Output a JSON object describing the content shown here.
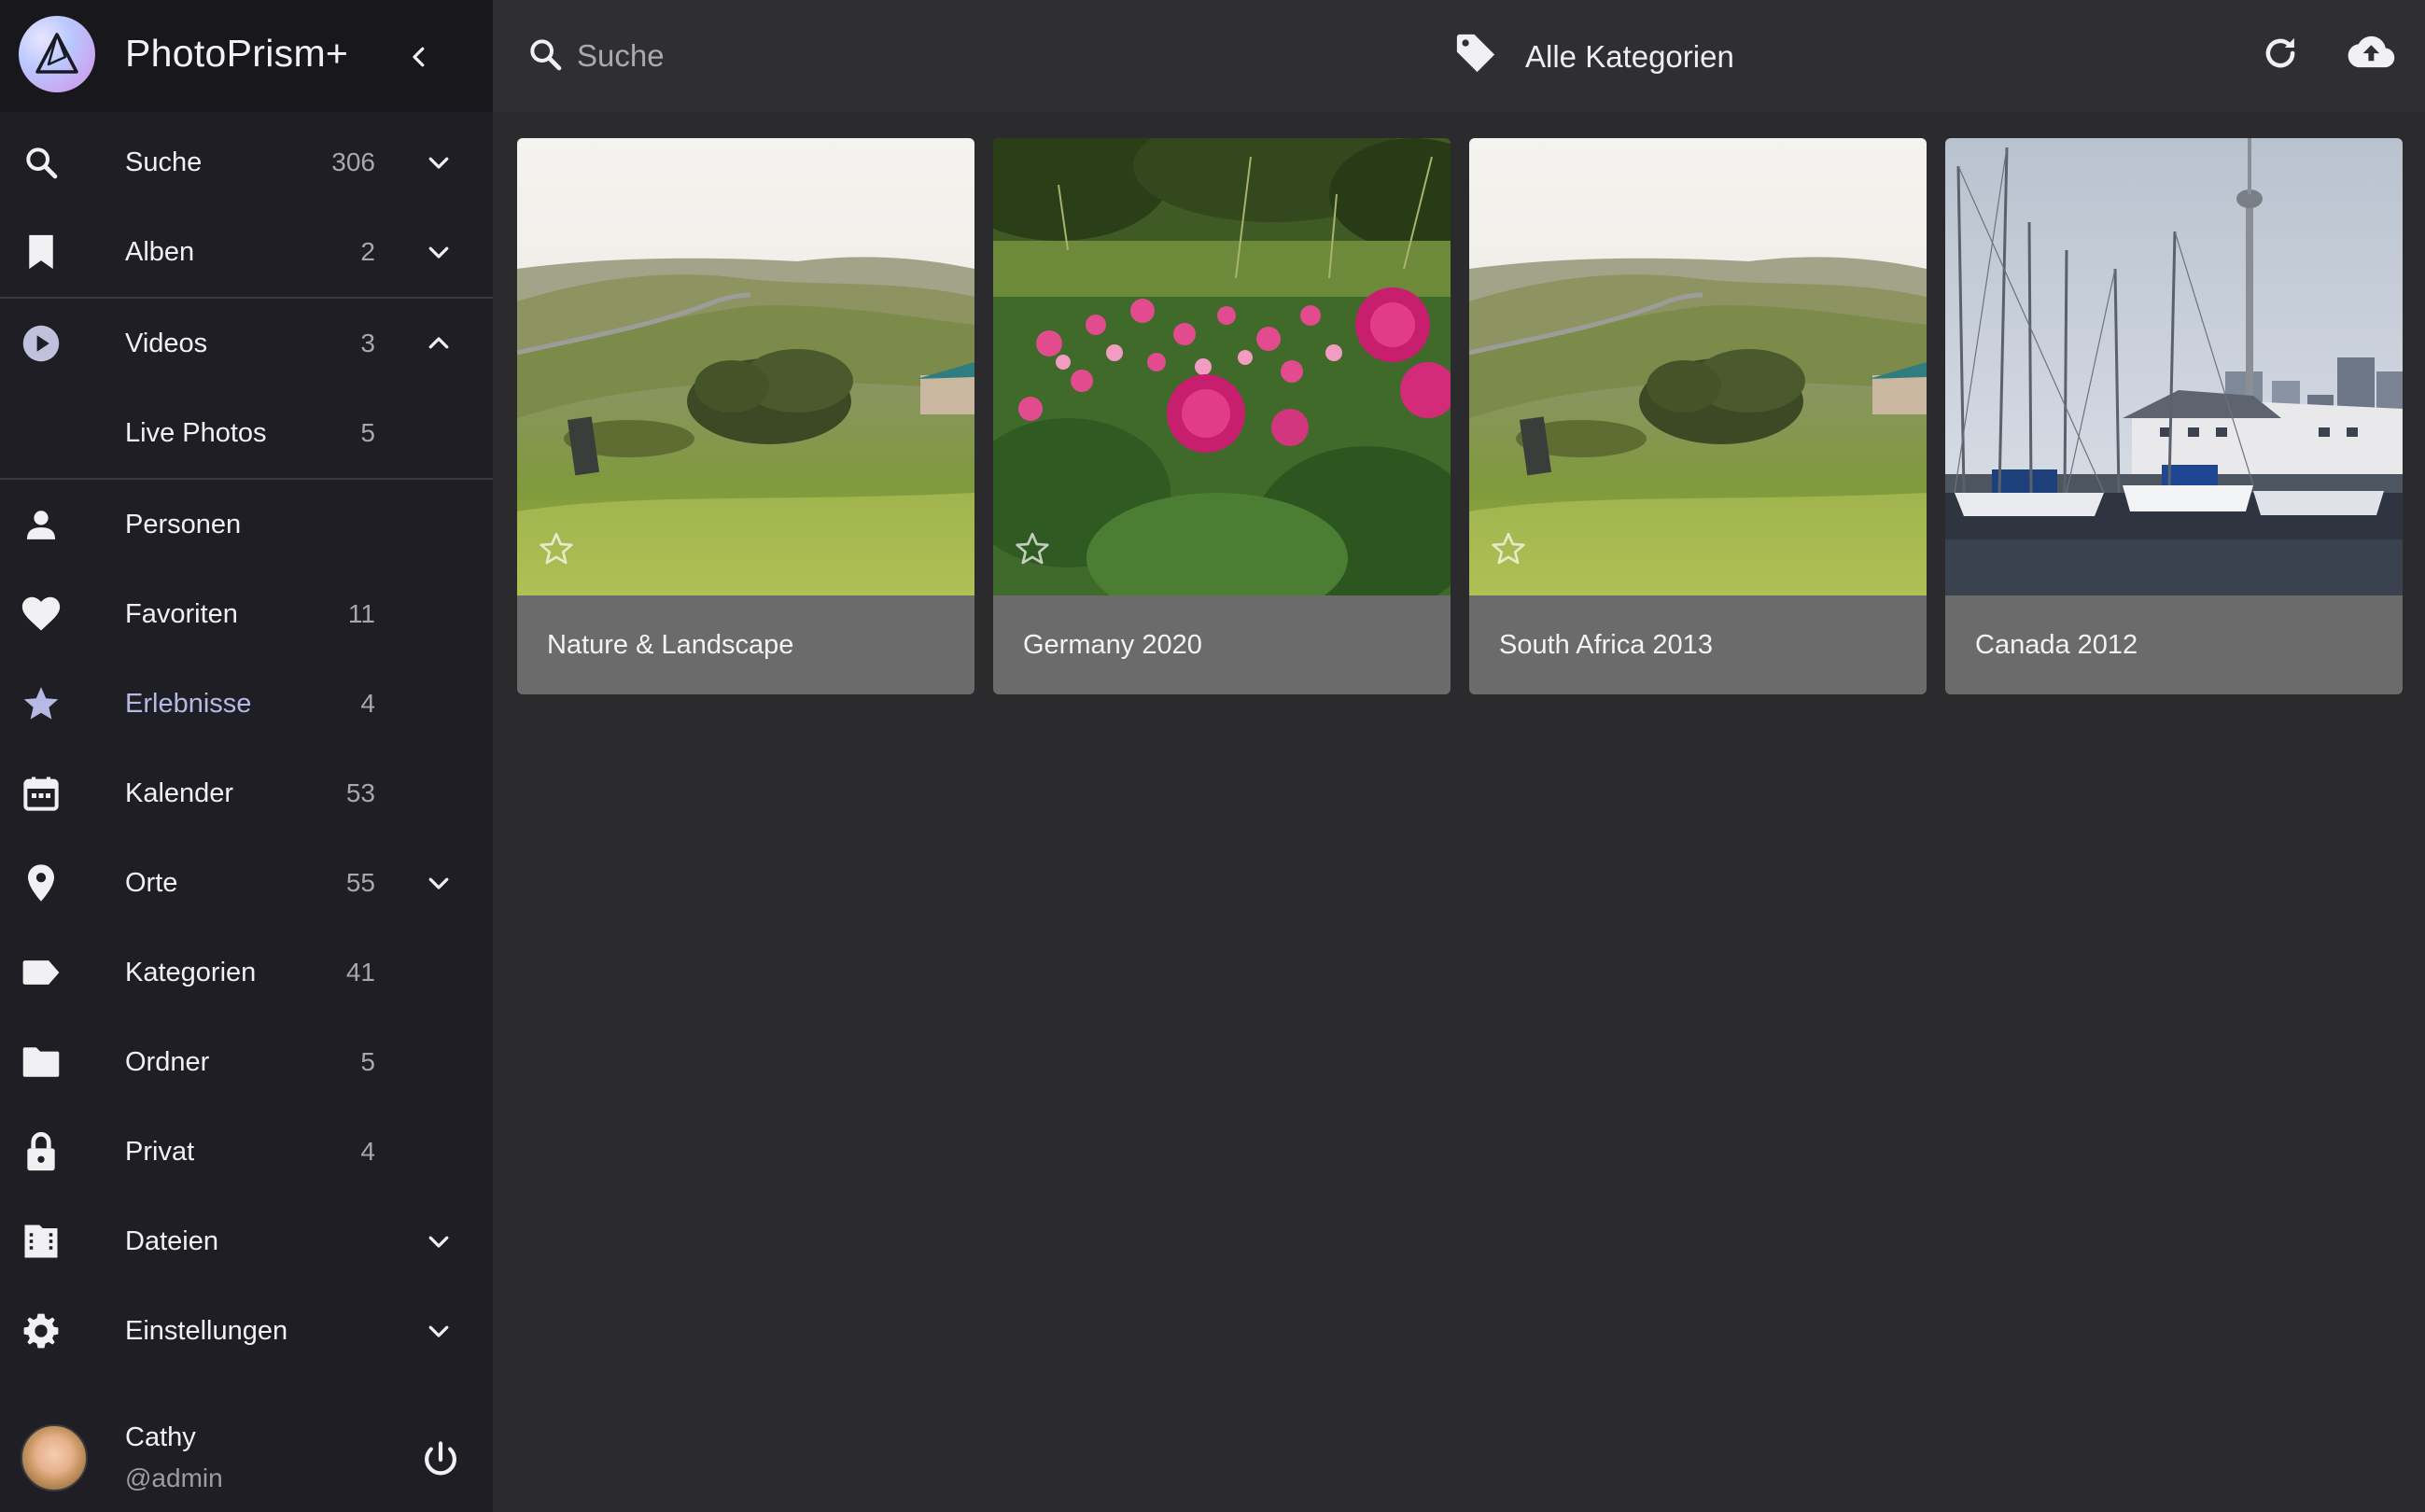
{
  "app": {
    "title": "PhotoPrism+"
  },
  "sidebar": {
    "items": [
      {
        "key": "search",
        "label": "Suche",
        "count": "306",
        "icon": "search-icon",
        "expand": "down"
      },
      {
        "key": "albums",
        "label": "Alben",
        "count": "2",
        "icon": "bookmark-icon",
        "expand": "down"
      },
      {
        "key": "videos",
        "label": "Videos",
        "count": "3",
        "icon": "play-circle-icon",
        "expand": "up"
      },
      {
        "key": "live",
        "label": "Live Photos",
        "count": "5"
      },
      {
        "key": "people",
        "label": "Personen",
        "count": "",
        "icon": "person-icon"
      },
      {
        "key": "favorites",
        "label": "Favoriten",
        "count": "11",
        "icon": "heart-icon"
      },
      {
        "key": "moments",
        "label": "Erlebnisse",
        "count": "4",
        "icon": "star-icon"
      },
      {
        "key": "calendar",
        "label": "Kalender",
        "count": "53",
        "icon": "calendar-icon"
      },
      {
        "key": "places",
        "label": "Orte",
        "count": "55",
        "icon": "map-pin-icon",
        "expand": "down"
      },
      {
        "key": "labels",
        "label": "Kategorien",
        "count": "41",
        "icon": "label-icon"
      },
      {
        "key": "folders",
        "label": "Ordner",
        "count": "5",
        "icon": "folder-icon"
      },
      {
        "key": "private",
        "label": "Privat",
        "count": "4",
        "icon": "lock-icon"
      },
      {
        "key": "library",
        "label": "Dateien",
        "count": "",
        "icon": "film-folder-icon",
        "expand": "down"
      },
      {
        "key": "settings",
        "label": "Einstellungen",
        "count": "",
        "icon": "gear-icon",
        "expand": "down"
      }
    ],
    "user": {
      "name": "Cathy",
      "handle": "@admin"
    }
  },
  "toolbar": {
    "search_placeholder": "Suche",
    "category_filter": "Alle Kategorien"
  },
  "cards": [
    {
      "title": "Nature & Landscape",
      "scene": "landscape"
    },
    {
      "title": "Germany 2020",
      "scene": "flowers"
    },
    {
      "title": "South Africa 2013",
      "scene": "landscape"
    },
    {
      "title": "Canada 2012",
      "scene": "harbor"
    }
  ],
  "colors": {
    "sidebar_bg": "#1f1e24",
    "topbar_bg": "#2f2f31",
    "content_bg": "#2b2b2d",
    "card_bg": "#6b6b6c",
    "accent_text": "#b6b9e4"
  }
}
